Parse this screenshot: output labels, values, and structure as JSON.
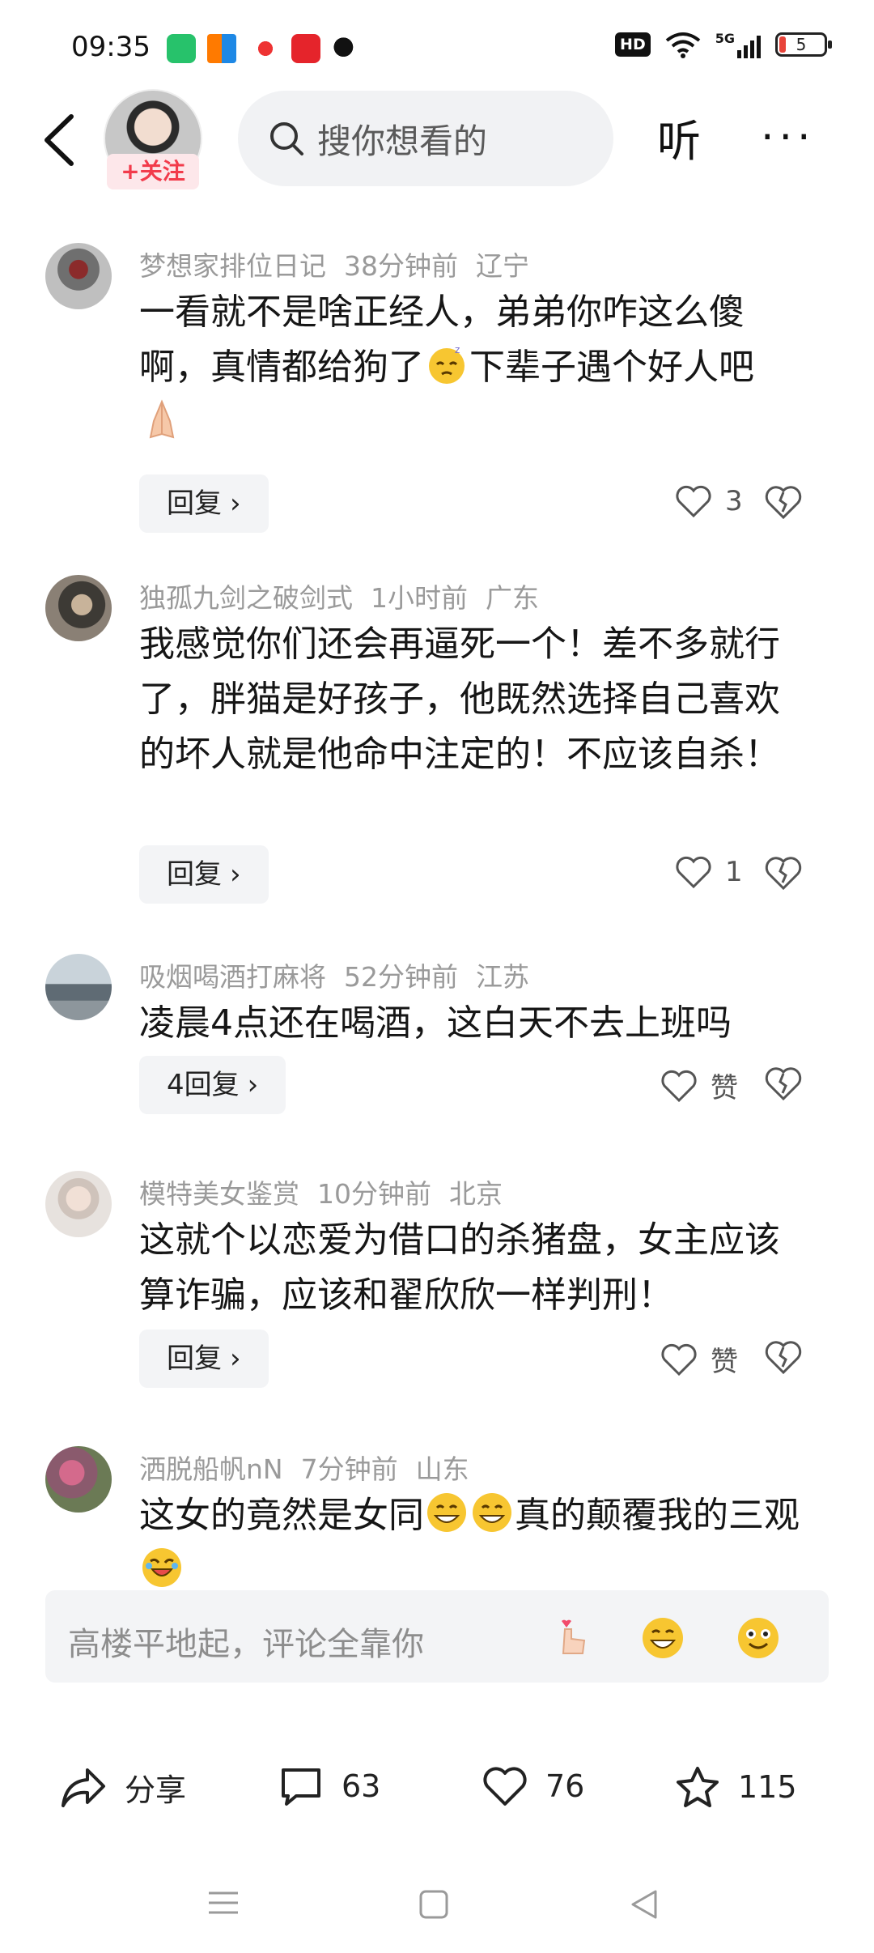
{
  "status_bar": {
    "time": "09:35",
    "hd": "HD",
    "network": "5G",
    "battery": "5"
  },
  "header": {
    "follow_label": "+关注",
    "search_placeholder": "搜你想看的",
    "listen_label": "听",
    "more_label": "···"
  },
  "comments": [
    {
      "user": "梦想家排位日记",
      "time": "38分钟前",
      "location": "辽宁",
      "text_parts": [
        "一看就不是啥正经人，弟弟你咋这么傻啊，真情都给狗了",
        "下辈子遇个好人吧"
      ],
      "reply_label": "回复",
      "like_count": "3"
    },
    {
      "user": "独孤九剑之破剑式",
      "time": "1小时前",
      "location": "广东",
      "text": "我感觉你们还会再逼死一个！差不多就行了，胖猫是好孩子，他既然选择自己喜欢的坏人就是他命中注定的！不应该自杀！",
      "reply_label": "回复",
      "like_count": "1"
    },
    {
      "user": "吸烟喝酒打麻将",
      "time": "52分钟前",
      "location": "江苏",
      "text": "凌晨4点还在喝酒，这白天不去上班吗",
      "reply_label": "4回复",
      "like_count": "赞"
    },
    {
      "user": "模特美女鉴赏",
      "time": "10分钟前",
      "location": "北京",
      "text": "这就个以恋爱为借口的杀猪盘，女主应该算诈骗，应该和翟欣欣一样判刑！",
      "reply_label": "回复",
      "like_count": "赞"
    },
    {
      "user": "洒脱船帆nN",
      "time": "7分钟前",
      "location": "山东",
      "text_parts": [
        "这女的竟然是女同",
        "真的颠覆我的三观"
      ]
    }
  ],
  "input_bar": {
    "placeholder": "高楼平地起，评论全靠你"
  },
  "actions": {
    "share": "分享",
    "comments": "63",
    "likes": "76",
    "favorites": "115"
  },
  "colors": {
    "accent_red": "#f23b4b",
    "meta_gray": "#9a9a9a",
    "button_bg": "#f3f4f6"
  }
}
